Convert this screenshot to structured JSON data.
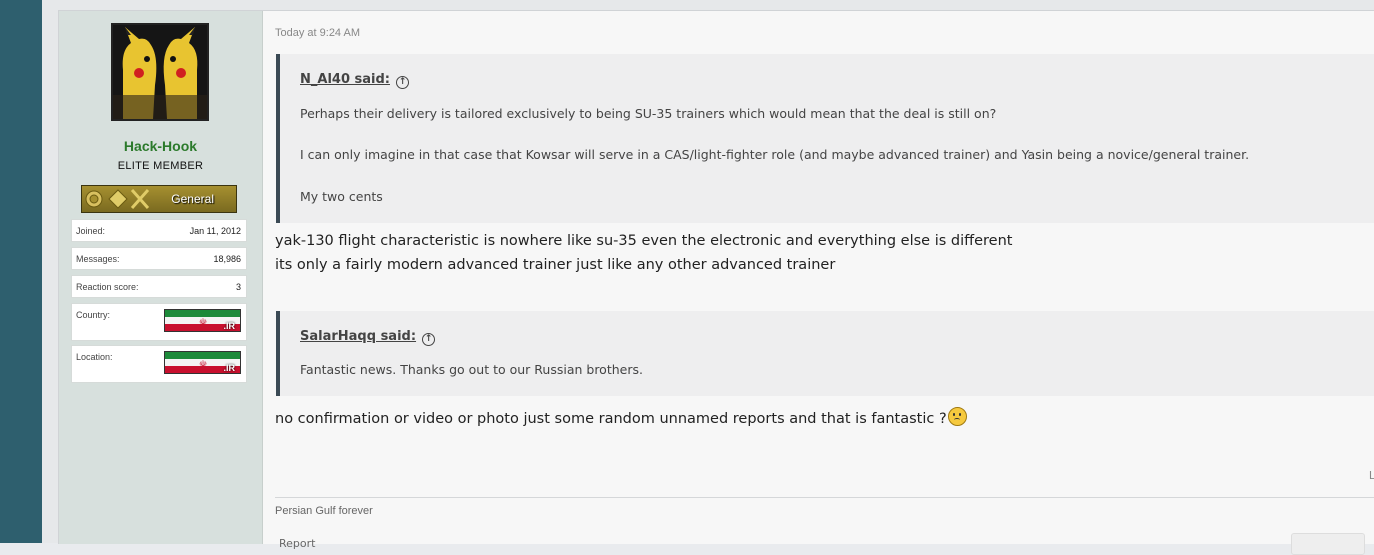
{
  "user": {
    "name": "Hack-Hook",
    "title": "ELITE MEMBER",
    "rank": "General",
    "stats": [
      {
        "label": "Joined:",
        "value": "Jan 11, 2012"
      },
      {
        "label": "Messages:",
        "value": "18,986"
      },
      {
        "label": "Reaction score:",
        "value": "3"
      }
    ],
    "country_label": "Country:",
    "location_label": "Location:",
    "flag_text": ".IR"
  },
  "post": {
    "timestamp": "Today at 9:24 AM",
    "quote1": {
      "author": "N_Al40 said:",
      "lines": [
        "Perhaps their delivery is tailored exclusively to being SU-35 trainers which would mean that the deal is still on?",
        "I can only imagine in that case that Kowsar will serve in a CAS/light-fighter role (and maybe advanced trainer) and Yasin being a novice/general trainer.",
        "My two cents"
      ]
    },
    "reply1": [
      "yak-130 flight characteristic is nowhere like su-35 even the electronic and everything else is different",
      "its only a fairly modern advanced trainer just like any other advanced trainer"
    ],
    "quote2": {
      "author": "SalarHaqq said:",
      "lines": [
        "Fantastic news. Thanks go out to our Russian brothers."
      ]
    },
    "reply2": "no confirmation or video or photo just some random unnamed reports and that is fantastic ?",
    "signature": "Persian Gulf forever",
    "report_label": "Report",
    "edge_char": "L"
  },
  "colors": {
    "username": "#2b7a2b",
    "quote_border": "#3b4a55",
    "sidebar": "#d7e0dd"
  }
}
